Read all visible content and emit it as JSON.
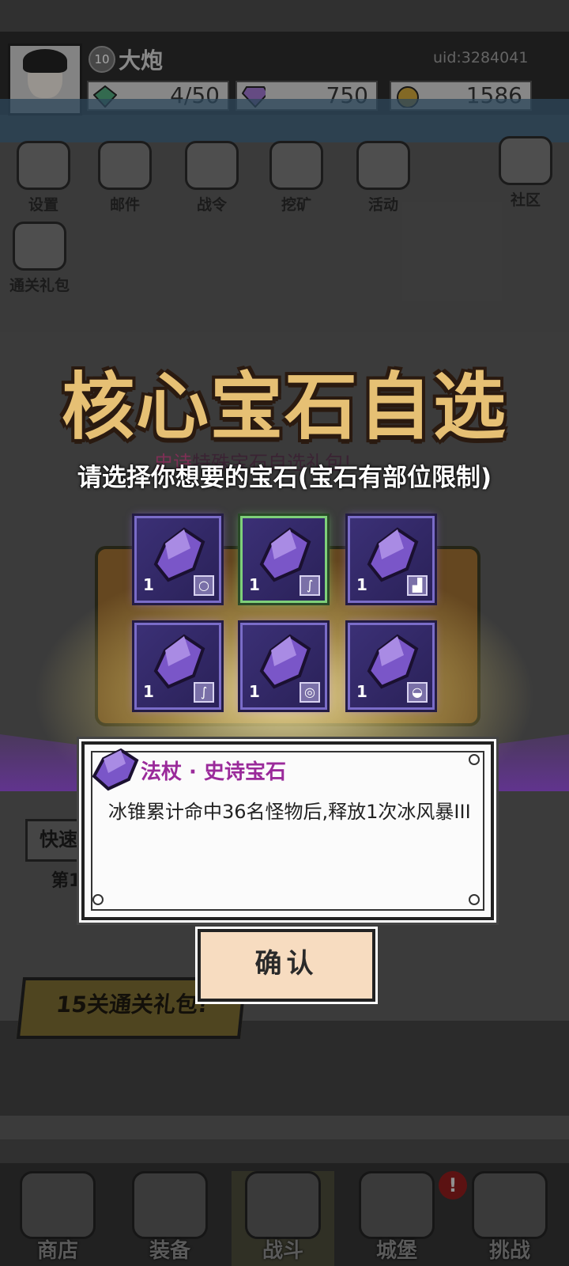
{
  "player": {
    "level": "10",
    "name": "大炮",
    "uid": "uid:3284041"
  },
  "resources": {
    "stamina": "4/50",
    "gems": "750",
    "coins": "1586"
  },
  "menu": [
    {
      "label": "设置",
      "icon": "gear-icon"
    },
    {
      "label": "邮件",
      "icon": "mail-icon"
    },
    {
      "label": "战令",
      "icon": "battle-pass-icon"
    },
    {
      "label": "挖矿",
      "icon": "mining-icon"
    },
    {
      "label": "活动",
      "icon": "event-laurel-icon"
    },
    {
      "label": "社区",
      "icon": "home-icon"
    },
    {
      "label": "通关礼包",
      "icon": "gift-bag-icon"
    }
  ],
  "stage": {
    "quick_label": "快速",
    "stage_label": "第1"
  },
  "gift_banner": "15关通关礼包!",
  "popup": {
    "title": "核心宝石自选",
    "subtitle_highlight": "史诗",
    "subtitle_text": "特殊宝石自选礼包!",
    "instruction": "请选择你想要的宝石(宝石有部位限制)",
    "gems": [
      {
        "count": "1",
        "slot": "ring-icon",
        "selected": false
      },
      {
        "count": "1",
        "slot": "staff-icon",
        "selected": true
      },
      {
        "count": "1",
        "slot": "boots-icon",
        "selected": false
      },
      {
        "count": "1",
        "slot": "staff-icon",
        "selected": false
      },
      {
        "count": "1",
        "slot": "necklace-icon",
        "selected": false
      },
      {
        "count": "1",
        "slot": "helmet-icon",
        "selected": false
      }
    ],
    "detail": {
      "title": "法杖 · 史诗宝石",
      "description": "冰锥累计命中36名怪物后,释放1次冰风暴III"
    },
    "confirm_label": "确认"
  },
  "bottom_nav": [
    {
      "label": "商店",
      "icon": "shop-icon"
    },
    {
      "label": "装备",
      "icon": "backpack-icon"
    },
    {
      "label": "战斗",
      "icon": "crossed-swords-icon"
    },
    {
      "label": "城堡",
      "icon": "castle-icon"
    },
    {
      "label": "挑战",
      "icon": "challenge-icon"
    }
  ],
  "alert_badge": "!",
  "colors": {
    "gem_purple": "#7a56c8",
    "selected_green": "#7ed07a",
    "title_gold": "#e6c074",
    "detail_title_magenta": "#9a2a9a"
  }
}
